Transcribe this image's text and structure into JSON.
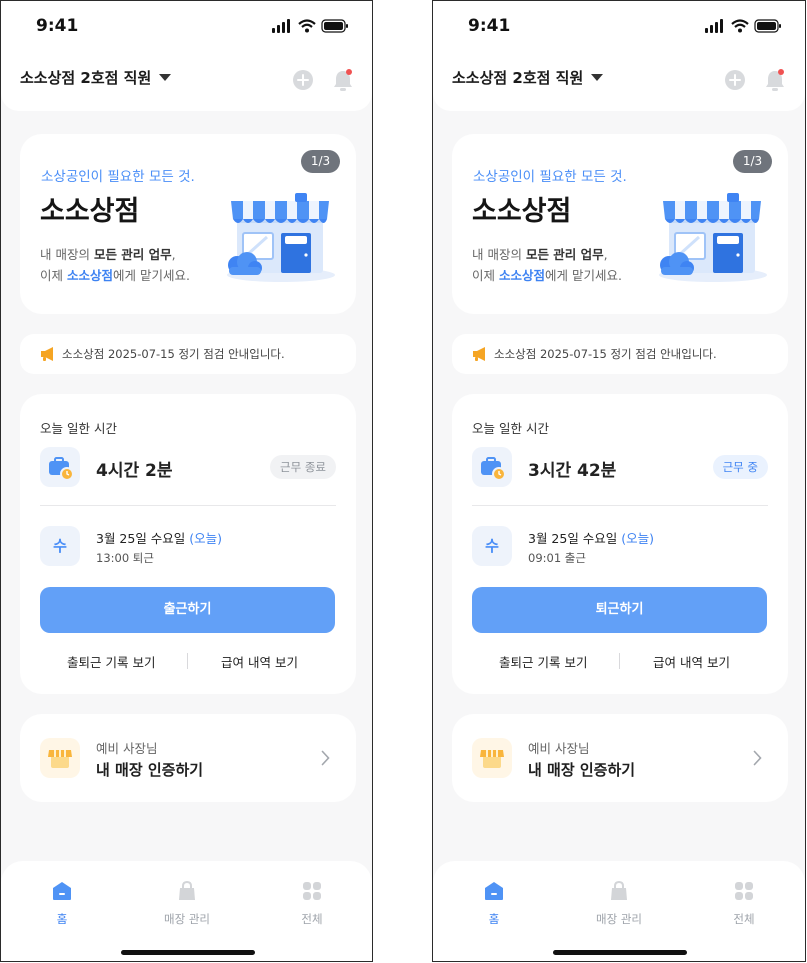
{
  "screens": [
    {
      "status": {
        "time": "9:41"
      },
      "header": {
        "store_name": "소소상점 2호점 직원"
      },
      "banner": {
        "subtitle": "소상공인이 필요한 모든 것.",
        "title": "소소상점",
        "desc_line1_prefix": "내 매장의 ",
        "desc_line1_bold": "모든 관리 업무",
        "desc_line1_suffix": ",",
        "desc_line2_prefix": "이제 ",
        "desc_line2_highlight": "소소상점",
        "desc_line2_suffix": "에게 맡기세요.",
        "page_indicator": "1/3"
      },
      "notice": {
        "text": "소소상점 2025-07-15 정기 점검 안내입니다."
      },
      "work": {
        "label": "오늘 일한 시간",
        "duration": "4시간 2분",
        "status": "근무 종료",
        "day": "수",
        "date": "3월 25일 수요일",
        "today": "(오늘)",
        "time_record": "13:00 퇴근",
        "action_button": "출근하기",
        "link_attendance": "출퇴근 기록 보기",
        "link_pay": "급여 내역 보기"
      },
      "owner": {
        "subtitle": "예비 사장님",
        "title": "내 매장 인증하기"
      },
      "tabs": [
        {
          "label": "홈"
        },
        {
          "label": "매장 관리"
        },
        {
          "label": "전체"
        }
      ]
    },
    {
      "status": {
        "time": "9:41"
      },
      "header": {
        "store_name": "소소상점 2호점 직원"
      },
      "banner": {
        "subtitle": "소상공인이 필요한 모든 것.",
        "title": "소소상점",
        "desc_line1_prefix": "내 매장의 ",
        "desc_line1_bold": "모든 관리 업무",
        "desc_line1_suffix": ",",
        "desc_line2_prefix": "이제 ",
        "desc_line2_highlight": "소소상점",
        "desc_line2_suffix": "에게 맡기세요.",
        "page_indicator": "1/3"
      },
      "notice": {
        "text": "소소상점 2025-07-15 정기 점검 안내입니다."
      },
      "work": {
        "label": "오늘 일한 시간",
        "duration": "3시간 42분",
        "status": "근무 중",
        "day": "수",
        "date": "3월 25일 수요일",
        "today": "(오늘)",
        "time_record": "09:01 출근",
        "action_button": "퇴근하기",
        "link_attendance": "출퇴근 기록 보기",
        "link_pay": "급여 내역 보기"
      },
      "owner": {
        "subtitle": "예비 사장님",
        "title": "내 매장 인증하기"
      },
      "tabs": [
        {
          "label": "홈"
        },
        {
          "label": "매장 관리"
        },
        {
          "label": "전체"
        }
      ]
    }
  ],
  "colors": {
    "accent": "#62a0f7",
    "accent_text": "#3d82f2",
    "badge_gray": "#6f747c",
    "notice_icon": "#f5a524",
    "owner_icon": "#f9b53c"
  },
  "icons": {
    "header": [
      "chevron-down-icon",
      "plus-circle-icon",
      "bell-icon"
    ],
    "notice": "megaphone-icon",
    "work": [
      "briefcase-clock-icon"
    ],
    "owner": "store-awning-icon",
    "tabs": [
      "home-icon",
      "shopping-bag-icon",
      "grid-icon"
    ]
  }
}
